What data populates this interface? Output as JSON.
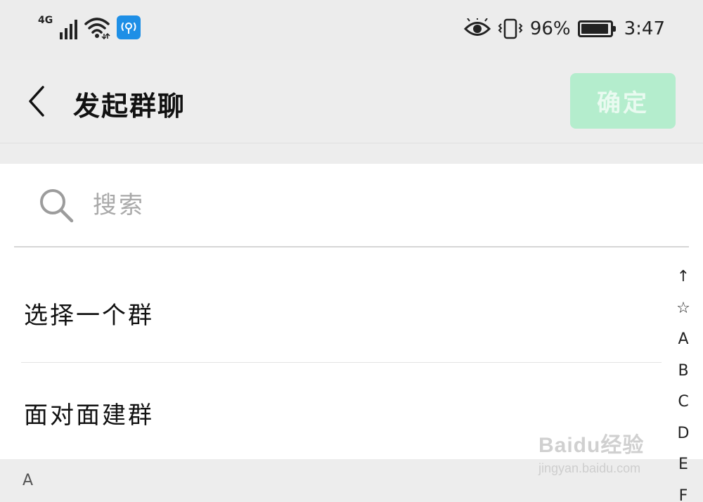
{
  "status_bar": {
    "network": "4G",
    "battery_percent_text": "96%",
    "battery_level": 0.96,
    "time": "3:47",
    "icons": [
      "signal-icon",
      "wifi-icon",
      "hotspot-app-icon",
      "eye-icon",
      "vibrate-icon",
      "battery-icon"
    ]
  },
  "header": {
    "title": "发起群聊",
    "confirm_label": "确定",
    "back_icon": "chevron-left-icon"
  },
  "search": {
    "placeholder": "搜索"
  },
  "menu": {
    "items": [
      {
        "label": "选择一个群"
      },
      {
        "label": "面对面建群"
      }
    ]
  },
  "section": {
    "letter": "A"
  },
  "index_bar": [
    "↑",
    "☆",
    "A",
    "B",
    "C",
    "D",
    "E",
    "F"
  ],
  "watermark": {
    "title": "Baidu经验",
    "subtitle": "jingyan.baidu.com"
  },
  "colors": {
    "confirm_bg": "#b4edcd",
    "confirm_text": "#e9faf0",
    "background": "#ededed"
  }
}
